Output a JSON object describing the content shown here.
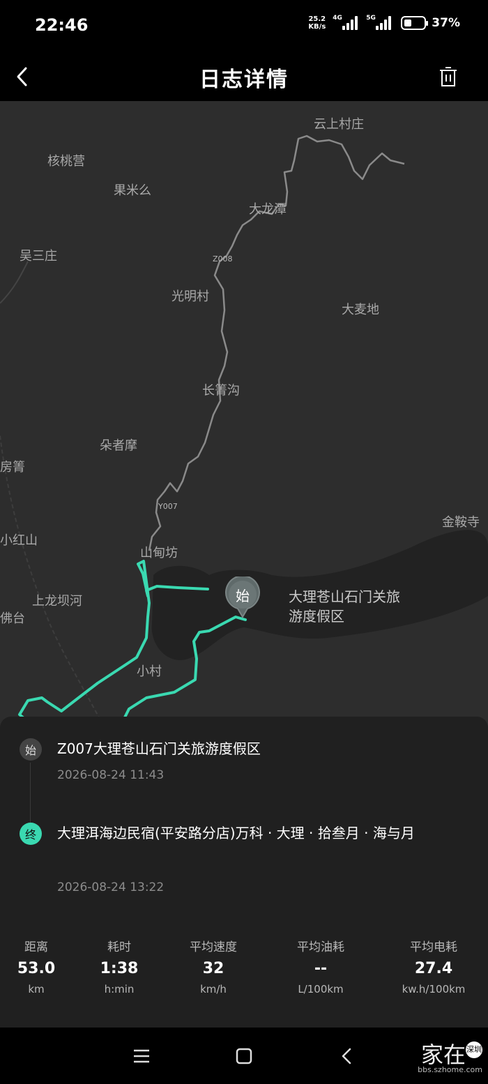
{
  "status_bar": {
    "time": "22:46",
    "net_speed_value": "25.2",
    "net_speed_unit": "KB/s",
    "signal1_tag": "4G",
    "signal2_tag": "5G",
    "battery": "37%"
  },
  "header": {
    "title": "日志详情",
    "back_icon": "back-chevron-icon",
    "delete_icon": "trash-icon"
  },
  "map": {
    "place_labels": [
      "云上村庄",
      "核桃营",
      "果米么",
      "大龙潭",
      "吴三庄",
      "光明村",
      "大麦地",
      "长箐沟",
      "朵者摩",
      "房箐",
      "金鞍寺",
      "小红山",
      "山甸坊",
      "上龙坝河",
      "佛台",
      "小村"
    ],
    "road_labels": [
      "Z008",
      "Y007"
    ],
    "poi_label": "大理苍山石门关旅游度假区",
    "start_pin_text": "始",
    "route_color": "#3ad9b1"
  },
  "trip": {
    "start": {
      "icon_text": "始",
      "name": "Z007大理苍山石门关旅游度假区",
      "time": "2026-08-24 11:43"
    },
    "end": {
      "icon_text": "终",
      "name": "大理洱海边民宿(平安路分店)万科 · 大理 · 拾叁月 · 海与月",
      "time": "2026-08-24 13:22"
    }
  },
  "stats": [
    {
      "label": "距离",
      "value": "53.0",
      "unit": "km"
    },
    {
      "label": "耗时",
      "value": "1:38",
      "unit": "h:min"
    },
    {
      "label": "平均速度",
      "value": "32",
      "unit": "km/h"
    },
    {
      "label": "平均油耗",
      "value": "--",
      "unit": "L/100km"
    },
    {
      "label": "平均电耗",
      "value": "27.4",
      "unit": "kw.h/100km"
    }
  ],
  "nav_bar": {
    "menu_icon": "menu-icon",
    "home_icon": "home-square-icon",
    "back_icon": "back-triangle-icon"
  },
  "watermark": {
    "main": "家在",
    "seal": "深圳",
    "url": "bbs.szhome.com"
  }
}
